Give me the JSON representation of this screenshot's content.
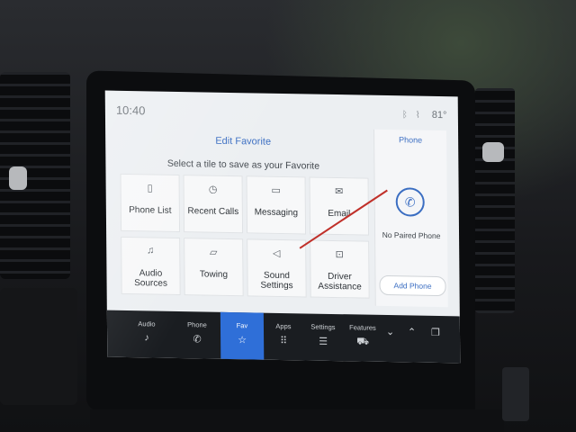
{
  "status": {
    "time": "10:40",
    "temperature": "81°",
    "icons": [
      "bluetooth-icon",
      "wireless-icon"
    ]
  },
  "favorites": {
    "title": "Edit Favorite",
    "subtitle": "Select a tile to save as your Favorite",
    "tiles": [
      {
        "label": "Phone List",
        "icon": "phone-list-icon"
      },
      {
        "label": "Recent Calls",
        "icon": "clock-icon"
      },
      {
        "label": "Messaging",
        "icon": "message-icon"
      },
      {
        "label": "Email",
        "icon": "envelope-icon"
      },
      {
        "label": "Audio Sources",
        "icon": "music-icon"
      },
      {
        "label": "Towing",
        "icon": "trailer-icon"
      },
      {
        "label": "Sound Settings",
        "icon": "speaker-icon"
      },
      {
        "label": "Driver Assistance",
        "icon": "driver-assist-icon"
      }
    ]
  },
  "phone_panel": {
    "title": "Phone",
    "status": "No Paired Phone",
    "add_label": "Add Phone"
  },
  "nav": {
    "items": [
      {
        "label": "Audio",
        "icon": "music-note-icon"
      },
      {
        "label": "Phone",
        "icon": "phone-icon"
      },
      {
        "label": "Fav",
        "icon": "star-icon",
        "active": true
      },
      {
        "label": "Apps",
        "icon": "apps-grid-icon"
      },
      {
        "label": "Settings",
        "icon": "sliders-icon"
      },
      {
        "label": "Features",
        "icon": "car-icon"
      }
    ]
  },
  "colors": {
    "accent": "#2f6fd8",
    "screen_bg": "#eceff2",
    "nav_bg": "#1a1d21"
  }
}
